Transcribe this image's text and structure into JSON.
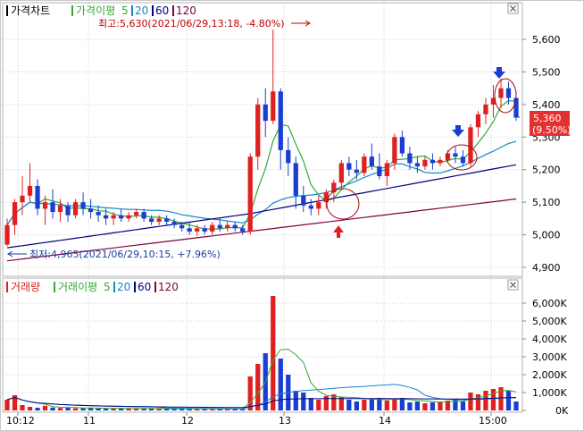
{
  "price_panel": {
    "title": "가격차트",
    "ma_label": "가격이평",
    "ma_periods": [
      "5",
      "20",
      "60",
      "120"
    ],
    "ma_colors": [
      "#33aa33",
      "#1188cc",
      "#000080",
      "#800040"
    ],
    "high_annotation": "최고:5,630(2021/06/29,13:18, -4.80%)",
    "low_annotation": "최저:4,965(2021/06/29,10:15, +7.96%)",
    "current_price": "5,360",
    "current_change": "(9.50%)",
    "y_ticks": [
      "5,600",
      "5,500",
      "5,400",
      "5,300",
      "5,200",
      "5,100",
      "5,000",
      "4,900"
    ]
  },
  "volume_panel": {
    "title": "거래량",
    "ma_label": "거래이평",
    "ma_periods": [
      "5",
      "20",
      "60",
      "120"
    ],
    "y_ticks": [
      "6,000K",
      "5,000K",
      "4,000K",
      "3,000K",
      "2,000K",
      "1,000K",
      "0K"
    ]
  },
  "x_ticks": [
    "10:12",
    "11",
    "12",
    "13",
    "14",
    "15:00"
  ],
  "icons": {
    "close": "close-icon",
    "arrows": [
      "down-arrow-icon",
      "up-arrow-icon"
    ]
  },
  "chart_data": {
    "type": "candlestick",
    "title": "가격차트",
    "ylim": [
      4900,
      5650
    ],
    "volume_ylim": [
      0,
      6500
    ],
    "x_ticks": [
      "10:12",
      "11",
      "12",
      "13",
      "14",
      "15:00"
    ],
    "series": [
      {
        "name": "가격",
        "ohlc": [
          [
            4970,
            5050,
            4965,
            5030
          ],
          [
            5030,
            5110,
            5000,
            5100
          ],
          [
            5100,
            5180,
            5060,
            5120
          ],
          [
            5120,
            5220,
            5100,
            5150
          ],
          [
            5150,
            5170,
            5060,
            5080
          ],
          [
            5080,
            5120,
            5030,
            5100
          ],
          [
            5100,
            5140,
            5050,
            5070
          ],
          [
            5070,
            5110,
            5040,
            5090
          ],
          [
            5090,
            5100,
            5040,
            5060
          ],
          [
            5060,
            5110,
            5050,
            5100
          ],
          [
            5100,
            5130,
            5060,
            5080
          ],
          [
            5080,
            5110,
            5050,
            5070
          ],
          [
            5070,
            5090,
            5040,
            5060
          ],
          [
            5060,
            5080,
            5030,
            5050
          ],
          [
            5050,
            5070,
            5030,
            5060
          ],
          [
            5060,
            5080,
            5040,
            5050
          ],
          [
            5050,
            5070,
            5040,
            5060
          ],
          [
            5060,
            5080,
            5050,
            5070
          ],
          [
            5070,
            5080,
            5040,
            5050
          ],
          [
            5050,
            5060,
            5030,
            5040
          ],
          [
            5040,
            5060,
            5030,
            5050
          ],
          [
            5050,
            5060,
            5030,
            5040
          ],
          [
            5040,
            5050,
            5020,
            5030
          ],
          [
            5030,
            5040,
            5010,
            5020
          ],
          [
            5020,
            5040,
            5000,
            5010
          ],
          [
            5010,
            5030,
            4995,
            5020
          ],
          [
            5020,
            5030,
            5000,
            5010
          ],
          [
            5010,
            5040,
            5000,
            5030
          ],
          [
            5030,
            5050,
            5010,
            5020
          ],
          [
            5020,
            5040,
            5010,
            5030
          ],
          [
            5030,
            5040,
            5010,
            5020
          ],
          [
            5020,
            5030,
            5000,
            5010
          ],
          [
            5010,
            5250,
            5000,
            5240
          ],
          [
            5240,
            5420,
            5200,
            5400
          ],
          [
            5400,
            5450,
            5300,
            5350
          ],
          [
            5350,
            5630,
            5340,
            5440
          ],
          [
            5440,
            5450,
            5200,
            5260
          ],
          [
            5260,
            5300,
            5180,
            5220
          ],
          [
            5220,
            5240,
            5080,
            5120
          ],
          [
            5120,
            5150,
            5070,
            5090
          ],
          [
            5090,
            5110,
            5060,
            5080
          ],
          [
            5080,
            5120,
            5060,
            5100
          ],
          [
            5100,
            5140,
            5080,
            5130
          ],
          [
            5130,
            5170,
            5100,
            5160
          ],
          [
            5160,
            5230,
            5140,
            5220
          ],
          [
            5220,
            5240,
            5180,
            5200
          ],
          [
            5200,
            5230,
            5170,
            5190
          ],
          [
            5190,
            5250,
            5180,
            5240
          ],
          [
            5240,
            5280,
            5200,
            5210
          ],
          [
            5210,
            5250,
            5170,
            5180
          ],
          [
            5180,
            5230,
            5150,
            5220
          ],
          [
            5220,
            5310,
            5200,
            5300
          ],
          [
            5300,
            5320,
            5240,
            5250
          ],
          [
            5250,
            5270,
            5200,
            5220
          ],
          [
            5220,
            5240,
            5190,
            5210
          ],
          [
            5210,
            5240,
            5200,
            5230
          ],
          [
            5230,
            5250,
            5200,
            5220
          ],
          [
            5220,
            5240,
            5210,
            5230
          ],
          [
            5230,
            5260,
            5220,
            5250
          ],
          [
            5250,
            5270,
            5220,
            5240
          ],
          [
            5240,
            5260,
            5210,
            5220
          ],
          [
            5220,
            5340,
            5210,
            5330
          ],
          [
            5330,
            5380,
            5300,
            5370
          ],
          [
            5370,
            5420,
            5340,
            5400
          ],
          [
            5400,
            5460,
            5360,
            5420
          ],
          [
            5420,
            5480,
            5390,
            5450
          ],
          [
            5450,
            5470,
            5400,
            5420
          ],
          [
            5420,
            5440,
            5350,
            5360
          ]
        ]
      },
      {
        "name": "거래량",
        "values": [
          600,
          850,
          300,
          200,
          150,
          260,
          160,
          140,
          150,
          120,
          140,
          130,
          110,
          100,
          120,
          130,
          110,
          90,
          100,
          120,
          110,
          90,
          80,
          100,
          90,
          80,
          70,
          90,
          80,
          100,
          90,
          80,
          1900,
          2600,
          3200,
          6400,
          2900,
          2000,
          1100,
          1000,
          700,
          600,
          800,
          900,
          750,
          600,
          500,
          600,
          650,
          700,
          550,
          600,
          700,
          450,
          500,
          400,
          450,
          500,
          550,
          600,
          500,
          1000,
          900,
          1100,
          1200,
          1300,
          1100,
          500
        ]
      }
    ]
  }
}
